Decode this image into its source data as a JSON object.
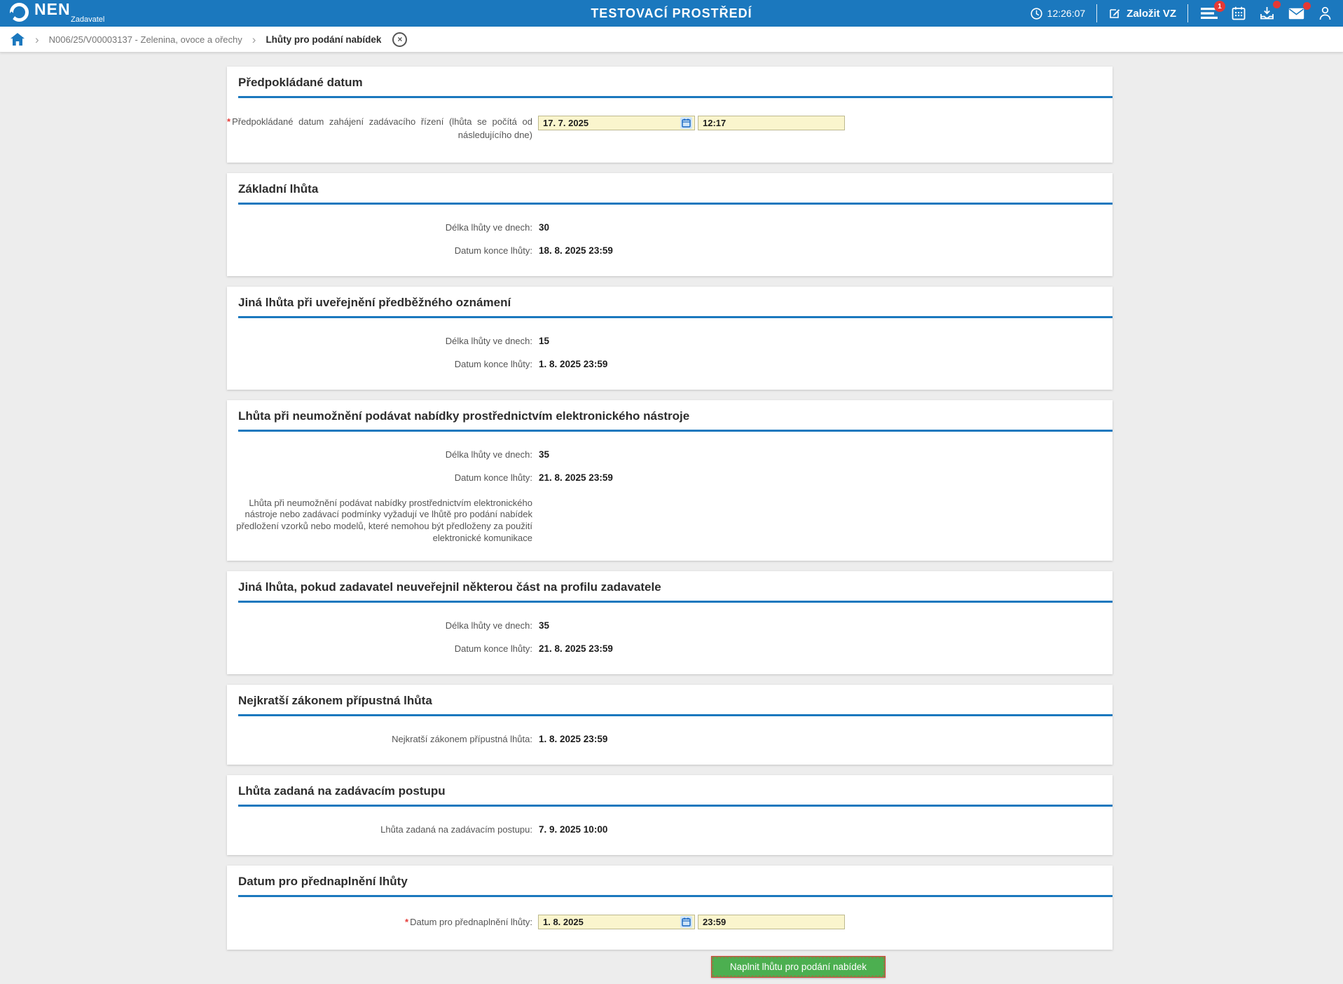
{
  "ui": {
    "required_marker": "*"
  },
  "colors": {
    "header_blue": "#1b78be",
    "input_yellow": "#faf5cd",
    "button_green": "#4caf50",
    "badge_red": "#e53935"
  },
  "header": {
    "logo_title": "NEN",
    "logo_subtitle": "Zadavatel",
    "env_title": "TESTOVACÍ PROSTŘEDÍ",
    "clock": "12:26:07",
    "create_vz_label": "Založit VZ",
    "menu_badge": "1"
  },
  "breadcrumb": {
    "item_procurement": "N006/25/V00003137 - Zelenina, ovoce a ořechy",
    "item_current": "Lhůty pro podání nabídek",
    "close_glyph": "×",
    "sep_glyph": "›"
  },
  "sections": [
    {
      "title": "Předpokládané datum",
      "label": "Předpokládané datum zahájení zadávacího řízení (lhůta se počítá od následujícího dne)",
      "date": "17. 7. 2025",
      "time": "12:17"
    },
    {
      "title": "Základní lhůta",
      "rows": [
        {
          "label": "Délka lhůty ve dnech:",
          "value": "30"
        },
        {
          "label": "Datum konce lhůty:",
          "value": "18. 8. 2025 23:59"
        }
      ]
    },
    {
      "title": "Jiná lhůta při uveřejnění předběžného oznámení",
      "rows": [
        {
          "label": "Délka lhůty ve dnech:",
          "value": "15"
        },
        {
          "label": "Datum konce lhůty:",
          "value": "1. 8. 2025 23:59"
        }
      ]
    },
    {
      "title": "Lhůta při neumožnění podávat nabídky prostřednictvím elektronického nástroje",
      "rows": [
        {
          "label": "Délka lhůty ve dnech:",
          "value": "35"
        },
        {
          "label": "Datum konce lhůty:",
          "value": "21. 8. 2025 23:59"
        }
      ],
      "note": "Lhůta při neumožnění podávat nabídky prostřednictvím elektronického nástroje nebo zadávací podmínky vyžadují ve lhůtě pro podání nabídek předložení vzorků nebo modelů, které nemohou být předloženy za použití elektronické komunikace"
    },
    {
      "title": "Jiná lhůta, pokud zadavatel neuveřejnil některou část na profilu zadavatele",
      "rows": [
        {
          "label": "Délka lhůty ve dnech:",
          "value": "35"
        },
        {
          "label": "Datum konce lhůty:",
          "value": "21. 8. 2025 23:59"
        }
      ]
    },
    {
      "title": "Nejkratší zákonem přípustná lhůta",
      "rows": [
        {
          "label": "Nejkratší zákonem přípustná lhůta:",
          "value": "1. 8. 2025 23:59"
        }
      ]
    },
    {
      "title": "Lhůta zadaná na zadávacím postupu",
      "rows": [
        {
          "label": "Lhůta zadaná na zadávacím postupu:",
          "value": "7. 9. 2025 10:00"
        }
      ]
    },
    {
      "title": "Datum pro přednaplnění lhůty",
      "label": "Datum pro přednaplnění lhůty:",
      "date": "1. 8. 2025",
      "time": "23:59"
    }
  ],
  "footer": {
    "fill_button": "Naplnit lhůtu pro podání nabídek"
  }
}
